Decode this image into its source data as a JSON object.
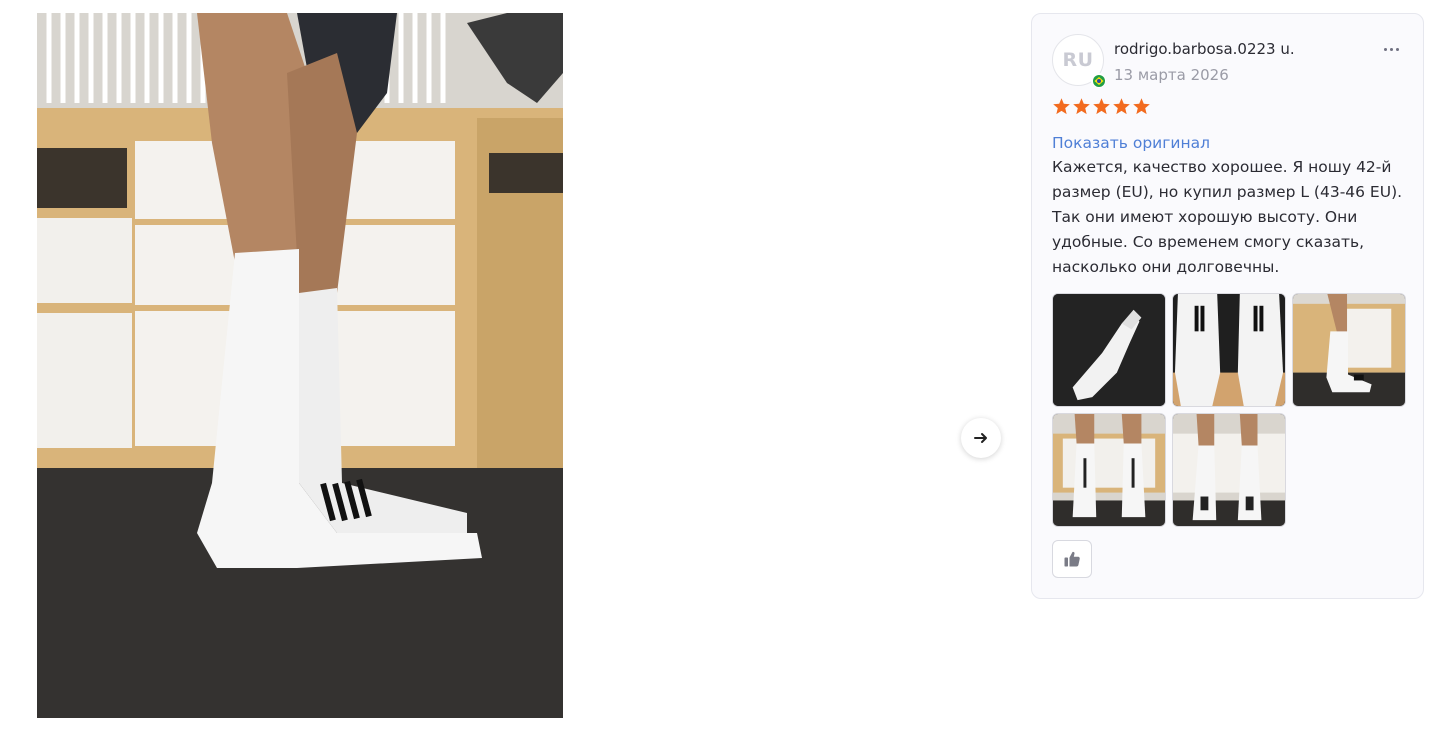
{
  "review": {
    "avatar_initials": "RU",
    "author": "rodrigo.barbosa.0223 u.",
    "date": "13 марта 2026",
    "rating": 5,
    "rating_max": 5,
    "show_original_label": "Показать оригинал",
    "text": "Кажется, качество хорошее. Я ношу 42-й размер (EU), но купил размер L (43-46 EU). Так они имеют хорошую высоту. Они удобные. Со временем смогу сказать, насколько они долговечны.",
    "photo_count": 5
  },
  "colors": {
    "star": "#f26b1f",
    "link": "#4f7fd6",
    "card_border": "#e6e7ee",
    "card_bg": "#fafafd"
  },
  "icons": {
    "next": "arrow-right-icon",
    "more": "more-dots-icon",
    "flag": "brazil-flag-icon",
    "like": "thumbs-up-icon"
  }
}
